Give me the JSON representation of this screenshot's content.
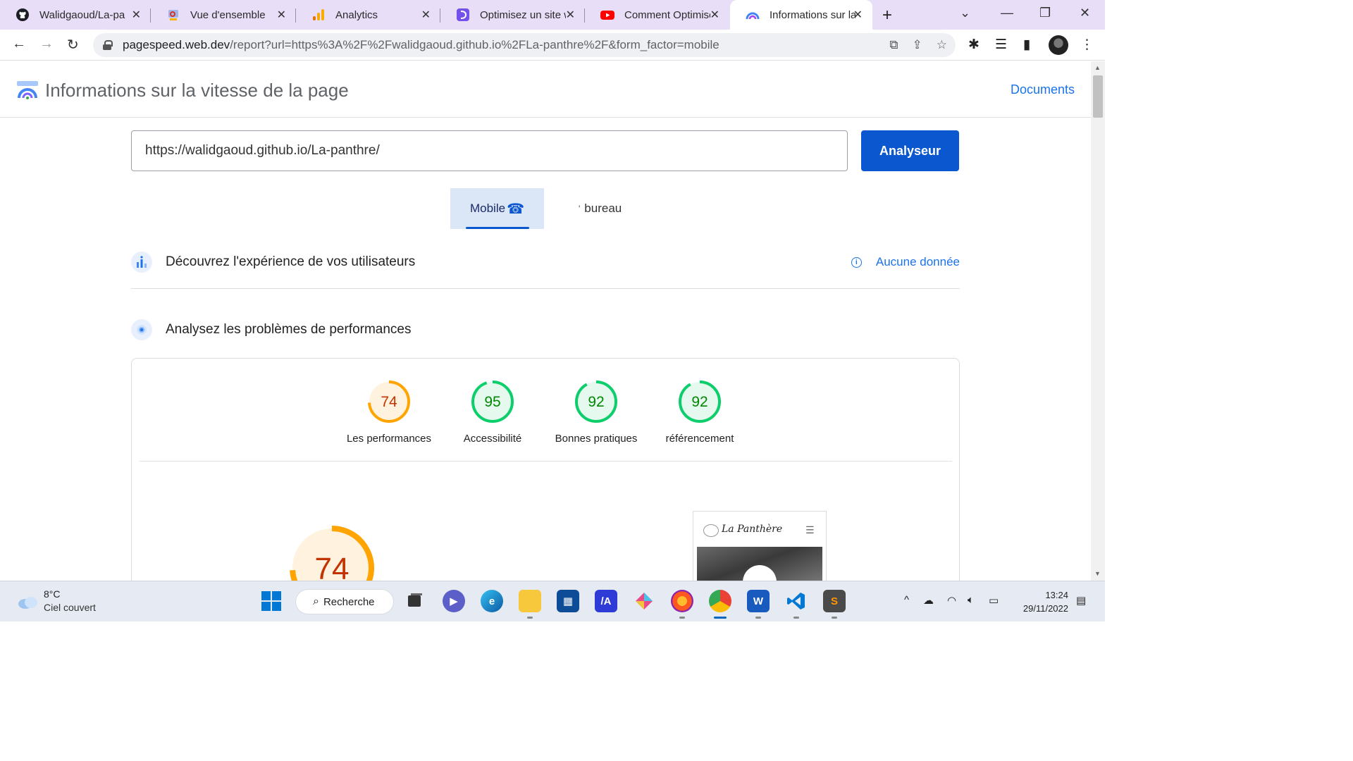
{
  "browser": {
    "tabs": [
      {
        "label": "Walidgaoud/La-par",
        "icon": "github-icon"
      },
      {
        "label": "Vue d'ensemble",
        "icon": "search-console-icon"
      },
      {
        "label": "Analytics",
        "icon": "analytics-icon"
      },
      {
        "label": "Optimisez un site w",
        "icon": "openclassrooms-icon"
      },
      {
        "label": "Comment Optimise",
        "icon": "youtube-icon"
      },
      {
        "label": "Informations sur la",
        "icon": "pagespeed-icon",
        "active": true
      }
    ],
    "url_host": "pagespeed.web.dev",
    "url_rest": "/report?url=https%3A%2F%2Fwalidgaoud.github.io%2FLa-panthre%2F&form_factor=mobile"
  },
  "header": {
    "title": "Informations sur la vitesse de la page",
    "docs_link": "Documents"
  },
  "analysis": {
    "url_value": "https://walidgaoud.github.io/La-panthre/",
    "analyze_button": "Analyseur"
  },
  "device_tabs": {
    "mobile": "Mobile",
    "desktop": "bureau",
    "desktop_prefix": "'"
  },
  "sections": {
    "field_data_title": "Découvrez l'expérience de vos utilisateurs",
    "field_data_status": "Aucune donnée",
    "lab_data_title": "Analysez les problèmes de performances"
  },
  "scores": [
    {
      "label": "Les performances",
      "value": "74",
      "status": "average",
      "color": "#c33300",
      "ring": "#ffa400",
      "bg": "#fff3e0",
      "fraction": 0.74
    },
    {
      "label": "Accessibilité",
      "value": "95",
      "status": "pass",
      "color": "#008800",
      "ring": "#0cce6b",
      "bg": "#e6f9ee",
      "fraction": 0.95
    },
    {
      "label": "Bonnes pratiques",
      "value": "92",
      "status": "pass",
      "color": "#008800",
      "ring": "#0cce6b",
      "bg": "#e6f9ee",
      "fraction": 0.92
    },
    {
      "label": "référencement",
      "value": "92",
      "status": "pass",
      "color": "#008800",
      "ring": "#0cce6b",
      "bg": "#e6f9ee",
      "fraction": 0.92
    }
  ],
  "main_score": {
    "value": "74",
    "fraction": 0.74,
    "color": "#c33300",
    "ring": "#ffa400"
  },
  "preview": {
    "site_title": "La Panthère"
  },
  "taskbar": {
    "weather_temp": "8°C",
    "weather_desc": "Ciel couvert",
    "search_label": "Recherche",
    "time": "13:24",
    "date": "29/11/2022"
  },
  "colors": {
    "accent": "#1a73e8",
    "button": "#0b57d0",
    "tab_strip": "#e8def8"
  }
}
